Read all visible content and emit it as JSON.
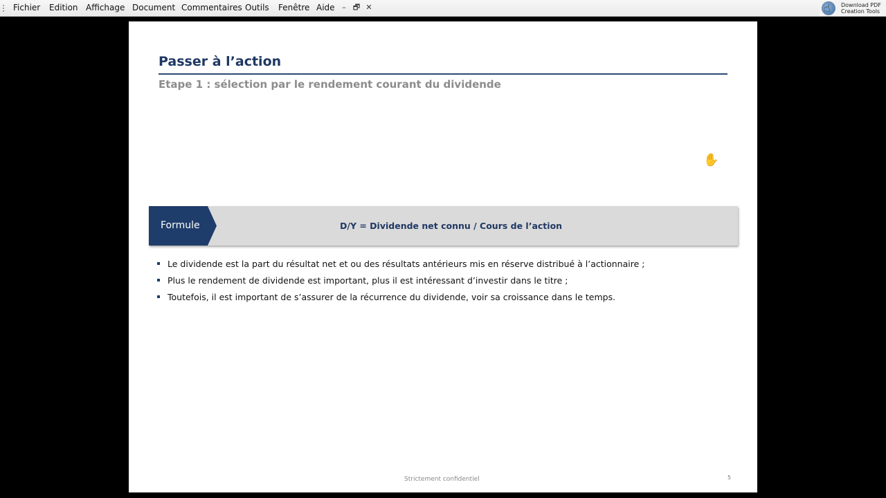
{
  "menubar": {
    "items": [
      "Fichier",
      "Edition",
      "Affichage",
      "Document",
      "Commentaires",
      "Outils",
      "Fenêtre",
      "Aide"
    ],
    "window_buttons": {
      "minimize": "–",
      "restore": "🗗",
      "close": "✕"
    }
  },
  "promo": {
    "line1": "Download PDF",
    "line2": "Creation Tools",
    "icon": "pdf-tools-icon"
  },
  "slide": {
    "title": "Passer à l’action",
    "subtitle": "Etape 1 : sélection par le rendement courant du dividende",
    "formula_label": "Formule",
    "formula": "D/Y = Dividende net connu / Cours de l’action",
    "bullets": [
      "Le dividende est la part du résultat net et ou des résultats antérieurs  mis en réserve distribué à l’actionnaire ;",
      "Plus le rendement de dividende est important, plus il est intéressant d’investir dans le titre ;",
      "Toutefois, il est important de s’assurer de la récurrence du dividende, voir sa croissance dans le temps."
    ],
    "footer": "Strictement confidentiel",
    "page_number": "5"
  },
  "colors": {
    "accent": "#1f3864",
    "tab": "#1f3d6b",
    "band": "#dadada",
    "subtitle": "#8c8c8c"
  },
  "cursors": {
    "hand": "hand-cursor-icon",
    "pointer": "pointer-cursor-icon"
  }
}
